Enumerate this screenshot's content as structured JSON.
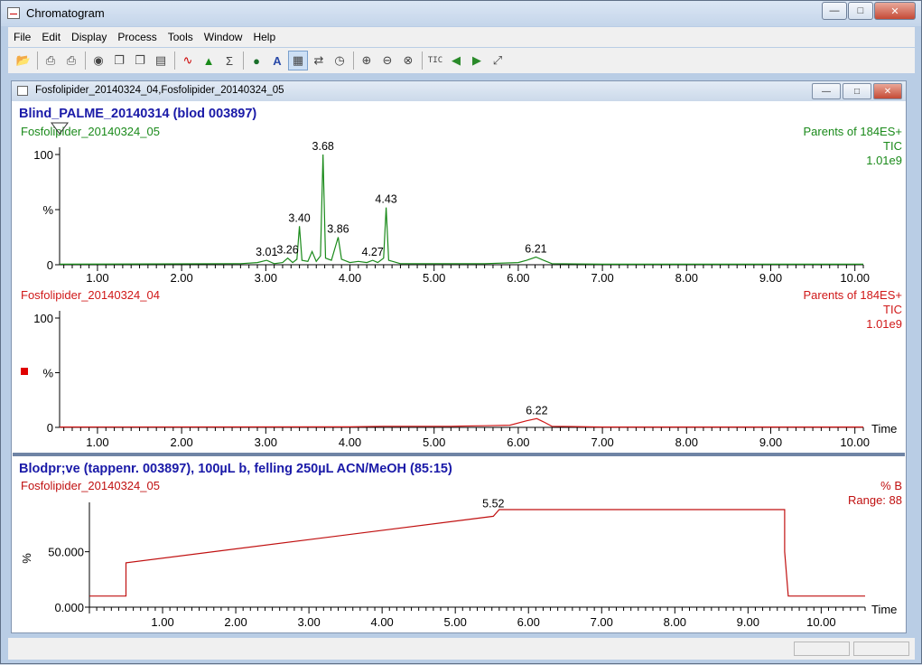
{
  "window": {
    "title": "Chromatogram"
  },
  "menu": [
    "File",
    "Edit",
    "Display",
    "Process",
    "Tools",
    "Window",
    "Help"
  ],
  "toolbar": {
    "tic_label": "TIC"
  },
  "child": {
    "title": "Fosfolipider_20140324_04,Fosfolipider_20140324_05"
  },
  "header1": "Blind_PALME_20140314 (blod 003897)",
  "header2": "Blodpr;ve (tappenr. 003897), 100µL b, felling 250µL ACN/MeOH (85:15)",
  "chart_data": [
    {
      "type": "line",
      "trace_name": "Fosfolipider_20140324_05",
      "right_labels": [
        "Parents of 184ES+",
        "TIC",
        "1.01e9"
      ],
      "color": "#1a8a1a",
      "y_ticks": [
        "100",
        "%",
        "0"
      ],
      "x_ticks": [
        "1.00",
        "2.00",
        "3.00",
        "4.00",
        "5.00",
        "6.00",
        "7.00",
        "8.00",
        "9.00",
        "10.00"
      ],
      "xlim": [
        0.55,
        10.1
      ],
      "ylim": [
        0,
        100
      ],
      "peak_labels": [
        {
          "x": 3.01,
          "y": 4,
          "label": "3.01"
        },
        {
          "x": 3.26,
          "y": 6,
          "label": "3.26"
        },
        {
          "x": 3.4,
          "y": 35,
          "label": "3.40"
        },
        {
          "x": 3.68,
          "y": 100,
          "label": "3.68"
        },
        {
          "x": 3.86,
          "y": 25,
          "label": "3.86"
        },
        {
          "x": 4.27,
          "y": 4,
          "label": "4.27"
        },
        {
          "x": 4.43,
          "y": 52,
          "label": "4.43"
        },
        {
          "x": 6.21,
          "y": 7,
          "label": "6.21"
        }
      ],
      "points": [
        [
          0.55,
          0.5
        ],
        [
          2.7,
          1
        ],
        [
          2.9,
          2
        ],
        [
          3.01,
          4
        ],
        [
          3.1,
          1
        ],
        [
          3.2,
          2
        ],
        [
          3.26,
          6
        ],
        [
          3.32,
          2
        ],
        [
          3.37,
          5
        ],
        [
          3.4,
          35
        ],
        [
          3.43,
          4
        ],
        [
          3.5,
          3
        ],
        [
          3.55,
          12
        ],
        [
          3.6,
          3
        ],
        [
          3.65,
          8
        ],
        [
          3.68,
          100
        ],
        [
          3.71,
          6
        ],
        [
          3.78,
          4
        ],
        [
          3.86,
          25
        ],
        [
          3.9,
          5
        ],
        [
          4.0,
          2
        ],
        [
          4.1,
          3
        ],
        [
          4.2,
          2
        ],
        [
          4.27,
          4
        ],
        [
          4.33,
          2
        ],
        [
          4.4,
          6
        ],
        [
          4.43,
          52
        ],
        [
          4.46,
          4
        ],
        [
          4.6,
          1
        ],
        [
          5.0,
          1
        ],
        [
          5.6,
          1
        ],
        [
          6.0,
          2
        ],
        [
          6.1,
          4
        ],
        [
          6.21,
          7
        ],
        [
          6.3,
          4
        ],
        [
          6.4,
          1
        ],
        [
          7.0,
          0.5
        ],
        [
          10.1,
          0.5
        ]
      ]
    },
    {
      "type": "line",
      "trace_name": "Fosfolipider_20140324_04",
      "right_labels": [
        "Parents of 184ES+",
        "TIC",
        "1.01e9"
      ],
      "color": "#d01818",
      "y_ticks": [
        "100",
        "%",
        "0"
      ],
      "x_ticks": [
        "1.00",
        "2.00",
        "3.00",
        "4.00",
        "5.00",
        "6.00",
        "7.00",
        "8.00",
        "9.00",
        "10.00"
      ],
      "x_axis_label": "Time",
      "xlim": [
        0.55,
        10.1
      ],
      "ylim": [
        0,
        100
      ],
      "peak_labels": [
        {
          "x": 6.22,
          "y": 8,
          "label": "6.22"
        }
      ],
      "points": [
        [
          0.55,
          0.3
        ],
        [
          4.0,
          0.5
        ],
        [
          4.4,
          1
        ],
        [
          4.8,
          1
        ],
        [
          5.2,
          1
        ],
        [
          5.6,
          1.5
        ],
        [
          5.9,
          2
        ],
        [
          6.1,
          6
        ],
        [
          6.22,
          8
        ],
        [
          6.3,
          5
        ],
        [
          6.4,
          1
        ],
        [
          7.0,
          0.3
        ],
        [
          10.1,
          0.3
        ]
      ]
    },
    {
      "type": "line",
      "trace_name": "Fosfolipider_20140324_05",
      "right_labels": [
        "% B",
        "Range: 88"
      ],
      "color": "#c01010",
      "y_ticks": [
        "50.000",
        "0.000"
      ],
      "y_unit": "%",
      "x_ticks": [
        "1.00",
        "2.00",
        "3.00",
        "4.00",
        "5.00",
        "6.00",
        "7.00",
        "8.00",
        "9.00",
        "10.00"
      ],
      "x_axis_label": "Time",
      "xlim": [
        0.0,
        10.6
      ],
      "ylim": [
        0,
        88
      ],
      "peak_labels": [
        {
          "x": 5.52,
          "y": 86,
          "label": "5.52"
        }
      ],
      "points": [
        [
          0.0,
          10
        ],
        [
          0.5,
          10
        ],
        [
          0.5,
          40
        ],
        [
          5.52,
          82
        ],
        [
          5.6,
          88
        ],
        [
          9.5,
          88
        ],
        [
          9.5,
          50
        ],
        [
          9.55,
          10
        ],
        [
          10.6,
          10
        ]
      ]
    }
  ],
  "status": [
    "",
    ""
  ]
}
